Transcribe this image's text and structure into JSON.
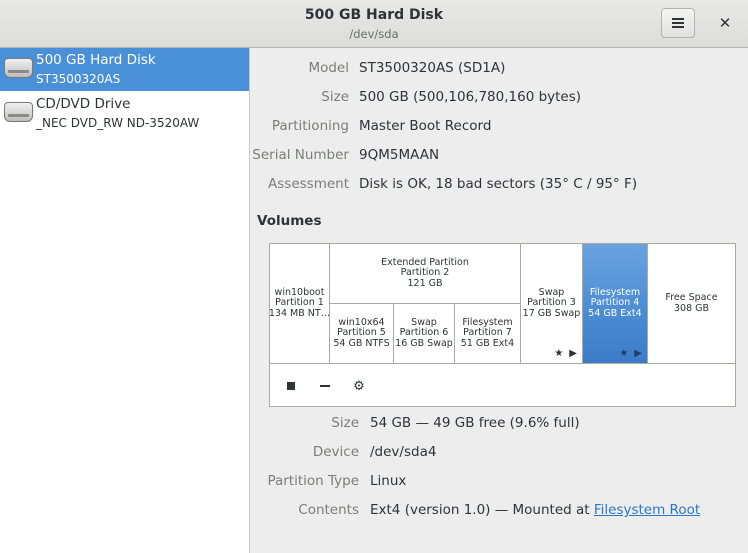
{
  "window": {
    "title": "500 GB Hard Disk",
    "subtitle": "/dev/sda"
  },
  "sidebar": {
    "items": [
      {
        "name": "500 GB Hard Disk",
        "model": "ST3500320AS",
        "selected": true
      },
      {
        "name": "CD/DVD Drive",
        "model": "_NEC DVD_RW ND-3520AW",
        "selected": false
      }
    ]
  },
  "drive_info": {
    "model_label": "Model",
    "model_value": "ST3500320AS (SD1A)",
    "size_label": "Size",
    "size_value": "500 GB (500,106,780,160 bytes)",
    "partitioning_label": "Partitioning",
    "partitioning_value": "Master Boot Record",
    "serial_label": "Serial Number",
    "serial_value": "9QM5MAAN",
    "assessment_label": "Assessment",
    "assessment_value": "Disk is OK, 18 bad sectors (35° C / 95° F)"
  },
  "volumes": {
    "heading": "Volumes",
    "segments": [
      {
        "line1": "win10boot",
        "line2": "Partition 1",
        "line3": "134 MB NT…"
      },
      {
        "line1": "Extended Partition",
        "line2": "Partition 2",
        "line3": "121 GB"
      },
      {
        "line1": "win10x64",
        "line2": "Partition 5",
        "line3": "54 GB NTFS"
      },
      {
        "line1": "Swap",
        "line2": "Partition 6",
        "line3": "16 GB Swap"
      },
      {
        "line1": "Filesystem",
        "line2": "Partition 7",
        "line3": "51 GB Ext4"
      },
      {
        "line1": "Swap",
        "line2": "Partition 3",
        "line3": "17 GB Swap"
      },
      {
        "line1": "Filesystem",
        "line2": "Partition 4",
        "line3": "54 GB Ext4",
        "selected": true
      },
      {
        "line1": "Free Space",
        "line2": "308 GB"
      }
    ],
    "icons": {
      "star": "★",
      "play": "▶"
    }
  },
  "toolbar": {
    "stop_icon": "stop-icon",
    "delete_icon": "minus-icon",
    "settings_icon": "gears-icon",
    "settings_glyph": "⚙"
  },
  "details": {
    "size_label": "Size",
    "size_value": "54 GB — 49 GB free (9.6% full)",
    "device_label": "Device",
    "device_value": "/dev/sda4",
    "ptype_label": "Partition Type",
    "ptype_value": "Linux",
    "contents_label": "Contents",
    "contents_value": "Ext4 (version 1.0) — Mounted at ",
    "contents_link": "Filesystem Root"
  },
  "colors": {
    "accent": "#4a90d9",
    "link": "#2a76c6"
  }
}
